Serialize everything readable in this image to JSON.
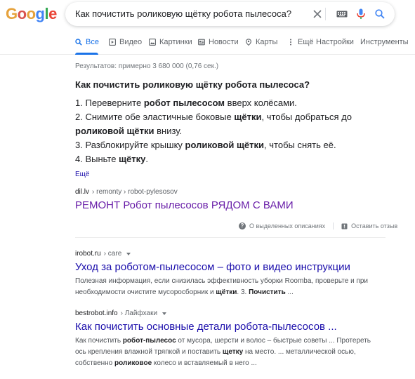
{
  "colors": {
    "link": "#1a0dab",
    "visited": "#681da8",
    "accent": "#1a73e8",
    "muted": "#70757a"
  },
  "logo": {
    "letters": [
      "G",
      "o",
      "o",
      "g",
      "l",
      "e"
    ],
    "colors": [
      "#e6a23c",
      "#d9534f",
      "#e6a23c",
      "#4285f4",
      "#34a853",
      "#ea4335"
    ]
  },
  "search": {
    "query": "Как почистить роликовую щётку робота пылесоса?",
    "icons": [
      "close-icon",
      "keyboard-icon",
      "microphone-icon",
      "search-icon"
    ]
  },
  "tabs": [
    {
      "label": "Все",
      "icon": "search-icon",
      "active": true
    },
    {
      "label": "Видео",
      "icon": "video-icon"
    },
    {
      "label": "Картинки",
      "icon": "image-icon"
    },
    {
      "label": "Новости",
      "icon": "news-icon"
    },
    {
      "label": "Карты",
      "icon": "map-pin-icon"
    },
    {
      "label": "Ещё",
      "icon": "more-vert-icon"
    },
    {
      "label": "Настройки"
    },
    {
      "label": "Инструменты"
    }
  ],
  "stats": "Результатов: примерно 3 680 000 (0,76 сек.)",
  "snippet": {
    "question": "Как почистить роликовую щётку робота пылесоса?",
    "steps": [
      {
        "num": "1.",
        "parts": [
          [
            "Переверните ",
            false
          ],
          [
            "робот пылесосом",
            true
          ],
          [
            " вверх колёсами.",
            false
          ]
        ]
      },
      {
        "num": "2.",
        "parts": [
          [
            "Снимите обе эластичные боковые ",
            false
          ],
          [
            "щётки",
            true
          ],
          [
            ", чтобы добраться до",
            false
          ]
        ],
        "cont": [
          [
            "роликовой щётки",
            true
          ],
          [
            " внизу.",
            false
          ]
        ]
      },
      {
        "num": "3.",
        "parts": [
          [
            "Разблокируйте крышку ",
            false
          ],
          [
            "роликовой щётки",
            true
          ],
          [
            ", чтобы снять её.",
            false
          ]
        ]
      },
      {
        "num": "4.",
        "parts": [
          [
            "Выньте ",
            false
          ],
          [
            "щётку",
            true
          ],
          [
            ".",
            false
          ]
        ]
      }
    ],
    "more": "Ещё",
    "source": {
      "domain": "dil.lv",
      "path": " › remonty › robot-pylesosov"
    },
    "title": "РЕМОНТ Робот пылесосов РЯДОМ С ВАМИ",
    "feedback": {
      "about": "О выделенных описаниях",
      "report": "Оставить отзыв"
    }
  },
  "results": [
    {
      "domain": "irobot.ru",
      "path": " › care",
      "title": "Уход за роботом-пылесосом – фото и видео инструкции",
      "desc": [
        [
          [
            "Полезная информация, если снизилась эффективность уборки Roomba, проверьте и при",
            false
          ]
        ],
        [
          [
            "необходимости очистите мусоросборник и ",
            false
          ],
          [
            "щётки",
            true
          ],
          [
            ". 3. ",
            false
          ],
          [
            "Почистить",
            true
          ],
          [
            " ...",
            false
          ]
        ]
      ]
    },
    {
      "domain": "bestrobot.info",
      "path": " › Лайфхаки",
      "title": "Как почистить основные детали робота-пылесосов ...",
      "desc": [
        [
          [
            "Как почистить ",
            false
          ],
          [
            "робот-пылесос",
            true
          ],
          [
            " от мусора, шерсти и волос – быстрые советы ... Протереть",
            false
          ]
        ],
        [
          [
            "ось крепления влажной тряпкой и поставить ",
            false
          ],
          [
            "щетку",
            true
          ],
          [
            " на место. ... металлической осью,",
            false
          ]
        ],
        [
          [
            "собственно ",
            false
          ],
          [
            "роликовое",
            true
          ],
          [
            " колесо и вставляемый в него ...",
            false
          ]
        ]
      ]
    }
  ]
}
